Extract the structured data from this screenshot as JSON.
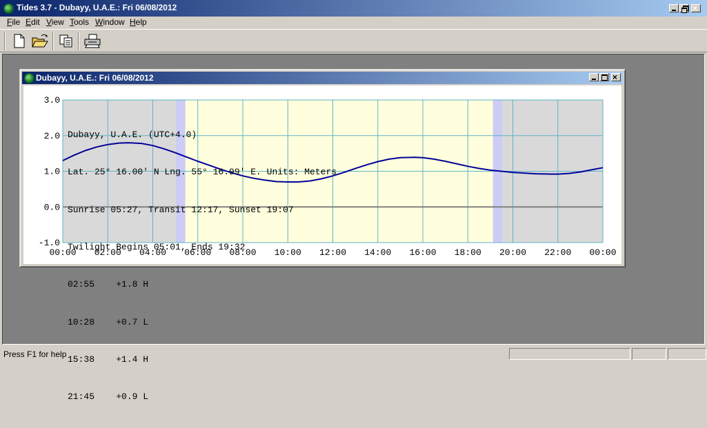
{
  "app": {
    "title": "Tides 3.7 - Dubayy, U.A.E.: Fri 06/08/2012"
  },
  "menu": {
    "items": [
      {
        "key": "F",
        "rest": "ile"
      },
      {
        "key": "E",
        "rest": "dit"
      },
      {
        "key": "V",
        "rest": "iew"
      },
      {
        "key": "T",
        "rest": "ools"
      },
      {
        "key": "W",
        "rest": "indow"
      },
      {
        "key": "H",
        "rest": "elp"
      }
    ]
  },
  "toolbar": {
    "buttons": [
      "new-document-icon",
      "open-folder-icon",
      "copy-icon",
      "print-icon"
    ]
  },
  "child_window": {
    "title": "Dubayy, U.A.E.: Fri 06/08/2012"
  },
  "info": {
    "location": "Dubayy, U.A.E. (UTC+4.0)",
    "coords": "Lat. 25° 16.00' N Lng. 55° 16.99' E. Units: Meters",
    "sun": "Sunrise 05:27, Transit 12:17, Sunset 19:07",
    "twilight": "Twilight Begins 05:01, Ends 19:32",
    "tides": [
      {
        "time": "02:55",
        "height": "+1.8",
        "type": "H"
      },
      {
        "time": "10:28",
        "height": "+0.7",
        "type": "L"
      },
      {
        "time": "15:38",
        "height": "+1.4",
        "type": "H"
      },
      {
        "time": "21:45",
        "height": "+0.9",
        "type": "L"
      }
    ]
  },
  "chart_data": {
    "type": "line",
    "series": [
      {
        "x": [
          "00:00",
          "00:30",
          "01:00",
          "01:30",
          "02:00",
          "02:30",
          "02:55",
          "03:30",
          "04:00",
          "04:30",
          "05:00",
          "05:30",
          "06:00",
          "06:30",
          "07:00",
          "07:30",
          "08:00",
          "08:30",
          "09:00",
          "09:30",
          "10:00",
          "10:28",
          "11:00",
          "11:30",
          "12:00",
          "12:30",
          "13:00",
          "13:30",
          "14:00",
          "14:30",
          "15:00",
          "15:38",
          "16:00",
          "16:30",
          "17:00",
          "17:30",
          "18:00",
          "18:30",
          "19:00",
          "19:30",
          "20:00",
          "20:30",
          "21:00",
          "21:45",
          "22:00",
          "22:30",
          "23:00",
          "23:30",
          "24:00"
        ],
        "values": [
          1.3,
          1.45,
          1.58,
          1.68,
          1.75,
          1.79,
          1.8,
          1.78,
          1.72,
          1.63,
          1.52,
          1.4,
          1.28,
          1.17,
          1.06,
          0.96,
          0.87,
          0.8,
          0.75,
          0.71,
          0.7,
          0.7,
          0.73,
          0.79,
          0.87,
          0.97,
          1.08,
          1.18,
          1.27,
          1.34,
          1.38,
          1.39,
          1.38,
          1.34,
          1.28,
          1.21,
          1.14,
          1.08,
          1.03,
          1.0,
          0.97,
          0.95,
          0.93,
          0.92,
          0.92,
          0.94,
          0.98,
          1.04,
          1.1
        ]
      }
    ],
    "categories": [
      "00:00",
      "02:00",
      "04:00",
      "06:00",
      "08:00",
      "10:00",
      "12:00",
      "14:00",
      "16:00",
      "18:00",
      "20:00",
      "22:00",
      "00:00"
    ],
    "y_ticks": [
      "3.0",
      "2.0",
      "1.0",
      "0.0",
      "-1.0"
    ],
    "ylim": [
      -1.0,
      3.0
    ],
    "xlim_hours": [
      0,
      24
    ],
    "grid": true,
    "shading": {
      "twilight_begin": 5.017,
      "sunrise": 5.45,
      "sunset": 19.117,
      "twilight_end": 19.533
    },
    "colors": {
      "curve": "#000099",
      "night": "#d9d9d9",
      "twilight": "#ccccf5",
      "day": "#ffffdd",
      "grid": "#5fb4c6",
      "zero": "#808080"
    }
  },
  "status": {
    "text": "Press F1 for help"
  }
}
